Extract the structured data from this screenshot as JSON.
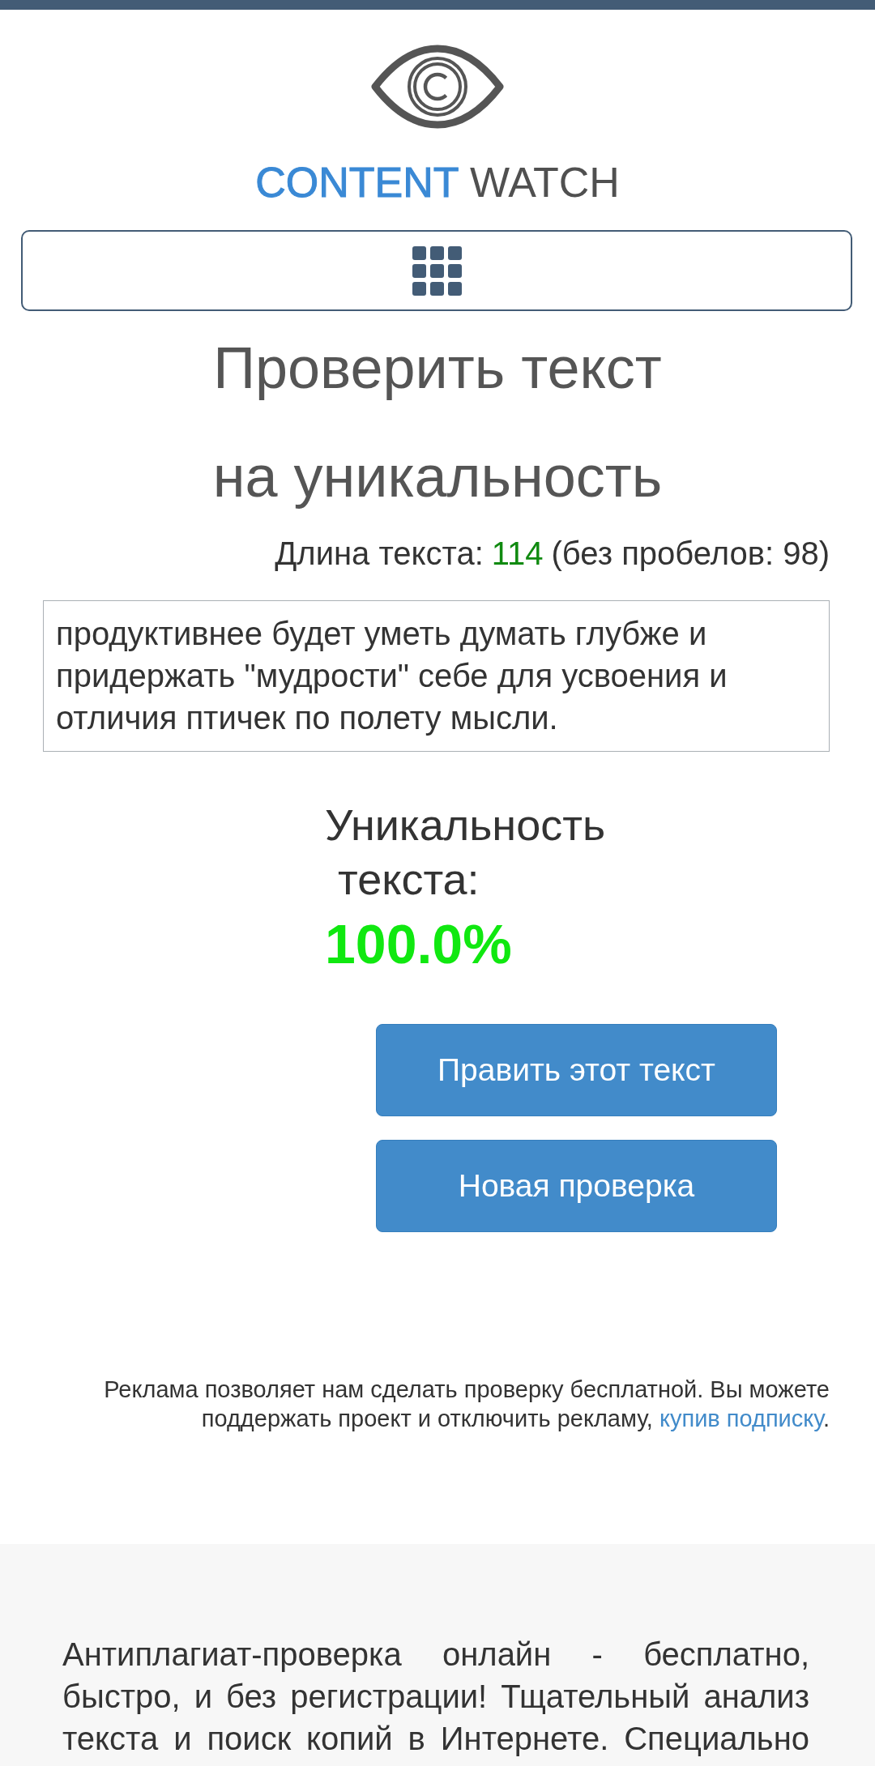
{
  "logo": {
    "accent_word": "CONTENT",
    "word": "WATCH"
  },
  "heading": "Проверить текст на уникальность",
  "text_length": {
    "label": "Длина текста:",
    "count": "114",
    "without_spaces": "(без пробелов: 98)"
  },
  "text_field": {
    "value": "продуктивнее будет уметь думать глубже и придержать \"мудрости\" себе для усвоения и отличия птичек по полету мысли."
  },
  "uniqueness": {
    "label": "Уникальность текста:",
    "value": "100.0%"
  },
  "buttons": [
    {
      "label": "Править этот текст"
    },
    {
      "label": "Новая проверка"
    }
  ],
  "ad_notice": {
    "text": "Реклама позволяет нам сделать проверку бесплатной. Вы можете поддержать проект и отключить рекламу,",
    "link": "купив подписку",
    "end": "."
  },
  "footer": {
    "description": "Антиплагиат-проверка онлайн - бесплатно, быстро, и без регистрации! Тщательный анализ текста и поиск копий в Интернете. Специально"
  }
}
